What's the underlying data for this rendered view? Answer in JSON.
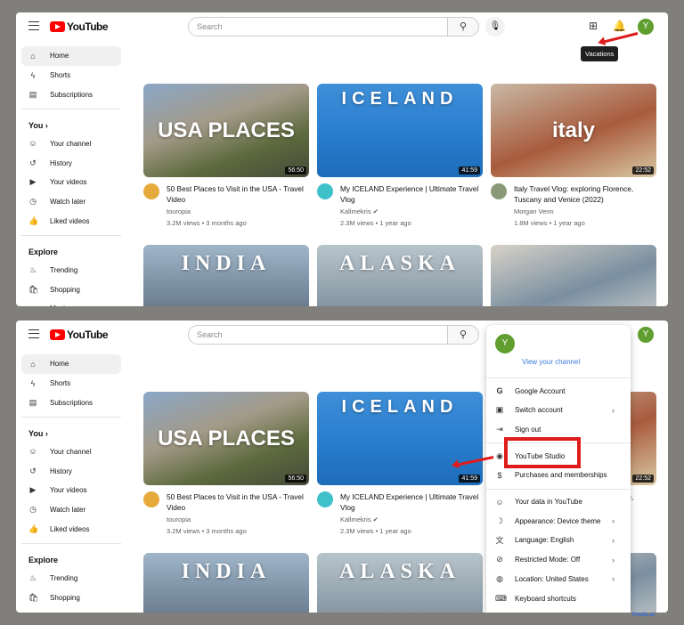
{
  "header": {
    "logo": "YouTube",
    "search_placeholder": "Search"
  },
  "tooltip": "Vacations",
  "avatar_letter": "Y",
  "sidebar": {
    "main": [
      {
        "label": "Home",
        "icon": "home-icon",
        "glyph": "⌂"
      },
      {
        "label": "Shorts",
        "icon": "shorts-icon",
        "glyph": "ϟ"
      },
      {
        "label": "Subscriptions",
        "icon": "subscriptions-icon",
        "glyph": "▤"
      }
    ],
    "you_heading": "You",
    "you": [
      {
        "label": "Your channel",
        "icon": "channel-icon",
        "glyph": "☺"
      },
      {
        "label": "History",
        "icon": "history-icon",
        "glyph": "↺"
      },
      {
        "label": "Your videos",
        "icon": "videos-icon",
        "glyph": "▶"
      },
      {
        "label": "Watch later",
        "icon": "watch-later-icon",
        "glyph": "◷"
      },
      {
        "label": "Liked videos",
        "icon": "like-icon",
        "glyph": "👍"
      }
    ],
    "explore_heading": "Explore",
    "explore": [
      {
        "label": "Trending",
        "icon": "trending-icon",
        "glyph": "♨"
      },
      {
        "label": "Shopping",
        "icon": "shopping-icon",
        "glyph": "🛍"
      },
      {
        "label": "Music",
        "icon": "music-icon",
        "glyph": "♪"
      }
    ]
  },
  "videos": [
    {
      "thumb_text": "USA PLACES",
      "duration": "56:50",
      "title": "50 Best Places to Visit in the USA - Travel Video",
      "channel": "touropia",
      "stats": "3.2M views • 3 months ago"
    },
    {
      "thumb_text": "ICELAND",
      "duration": "41:59",
      "title": "My ICELAND Experience | Ultimate Travel Vlog",
      "channel": "Kallmekris ✔",
      "stats": "2.3M views • 1 year ago"
    },
    {
      "thumb_text": "italy",
      "duration": "22:52",
      "title": "Italy Travel Vlog: exploring Florence, Tuscany and Venice (2022)",
      "channel": "Morgan Venn",
      "stats": "1.8M views • 1 year ago"
    }
  ],
  "row2": [
    {
      "thumb_text": "INDIA"
    },
    {
      "thumb_text": "ALASKA"
    },
    {
      "thumb_text": ""
    }
  ],
  "account_menu": {
    "view_channel": "View your channel",
    "groups": [
      [
        {
          "label": "Google Account",
          "icon": "google-icon",
          "glyph": "G"
        },
        {
          "label": "Switch account",
          "icon": "switch-account-icon",
          "glyph": "▣",
          "chevron": true
        },
        {
          "label": "Sign out",
          "icon": "sign-out-icon",
          "glyph": "⇥"
        }
      ],
      [
        {
          "label": "YouTube Studio",
          "icon": "studio-icon",
          "glyph": "◉"
        },
        {
          "label": "Purchases and memberships",
          "icon": "purchases-icon",
          "glyph": "$"
        }
      ],
      [
        {
          "label": "Your data in YouTube",
          "icon": "data-icon",
          "glyph": "☺"
        },
        {
          "label": "Appearance: Device theme",
          "icon": "theme-icon",
          "glyph": "☽",
          "chevron": true
        },
        {
          "label": "Language: English",
          "icon": "language-icon",
          "glyph": "文",
          "chevron": true
        },
        {
          "label": "Restricted Mode: Off",
          "icon": "restricted-icon",
          "glyph": "⊘",
          "chevron": true
        },
        {
          "label": "Location: United States",
          "icon": "globe-icon",
          "glyph": "◍",
          "chevron": true
        },
        {
          "label": "Keyboard shortcuts",
          "icon": "keyboard-icon",
          "glyph": "⌨"
        }
      ]
    ]
  },
  "watermark": "Predis.ai"
}
